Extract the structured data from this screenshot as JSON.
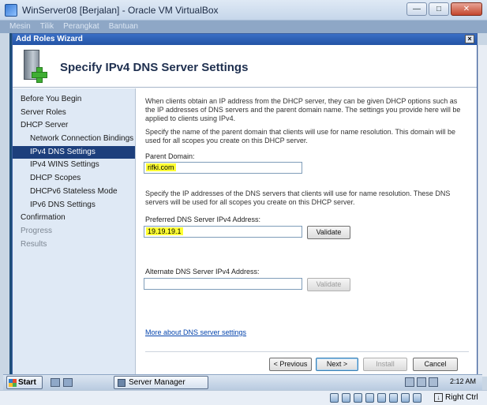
{
  "vbox": {
    "title": "WinServer08 [Berjalan] - Oracle VM VirtualBox",
    "menu": [
      "Mesin",
      "Tilik",
      "Perangkat",
      "Bantuan"
    ],
    "host_key_label": "Right Ctrl"
  },
  "wizard": {
    "window_title": "Add Roles Wizard",
    "close_glyph": "×",
    "heading": "Specify IPv4 DNS Server Settings",
    "nav": [
      {
        "label": "Before You Begin",
        "state": "normal"
      },
      {
        "label": "Server Roles",
        "state": "normal"
      },
      {
        "label": "DHCP Server",
        "state": "normal"
      },
      {
        "label": "Network Connection Bindings",
        "state": "sub"
      },
      {
        "label": "IPv4 DNS Settings",
        "state": "active"
      },
      {
        "label": "IPv4 WINS Settings",
        "state": "sub"
      },
      {
        "label": "DHCP Scopes",
        "state": "sub"
      },
      {
        "label": "DHCPv6 Stateless Mode",
        "state": "sub"
      },
      {
        "label": "IPv6 DNS Settings",
        "state": "sub"
      },
      {
        "label": "Confirmation",
        "state": "normal"
      },
      {
        "label": "Progress",
        "state": "disabled"
      },
      {
        "label": "Results",
        "state": "disabled"
      }
    ],
    "intro": "When clients obtain an IP address from the DHCP server, they can be given DHCP options such as the IP addresses of DNS servers and the parent domain name. The settings you provide here will be applied to clients using IPv4.",
    "domain_desc": "Specify the name of the parent domain that clients will use for name resolution. This domain will be used for all scopes you create on this DHCP server.",
    "parent_domain_label": "Parent Domain:",
    "parent_domain_value": "rifki.com",
    "dns_desc": "Specify the IP addresses of the DNS servers that clients will use for name resolution. These DNS servers will be used for all scopes you create on this DHCP server.",
    "preferred_label": "Preferred DNS Server IPv4 Address:",
    "preferred_value": "19.19.19.1",
    "alternate_label": "Alternate DNS Server IPv4 Address:",
    "alternate_value": "",
    "validate_label": "Validate",
    "more_link": "More about DNS server settings",
    "buttons": {
      "previous": "< Previous",
      "next": "Next >",
      "install": "Install",
      "cancel": "Cancel"
    }
  },
  "taskbar": {
    "start": "Start",
    "task": "Server Manager",
    "clock": "2:12 AM"
  }
}
